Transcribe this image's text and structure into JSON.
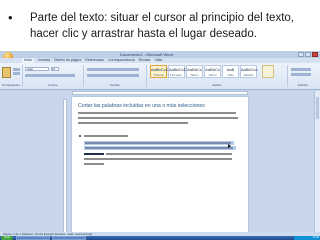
{
  "slide": {
    "bullet": "•",
    "text": "Parte del texto: situar el cursor al principio del texto, hacer clic y arrastrar hasta el lugar deseado."
  },
  "word_window": {
    "title": "Documento1 - Microsoft Word",
    "tabs": [
      "Inicio",
      "Insertar",
      "Diseño de página",
      "Referencias",
      "Correspondencia",
      "Revisar",
      "Vista"
    ],
    "active_tab": "Inicio",
    "font_name": "Arial",
    "font_size": "11",
    "groups": [
      "Portapapeles",
      "Fuente",
      "Párrafo",
      "Estilos",
      "Edición"
    ],
    "styles": [
      {
        "sample": "AaBbCcDc",
        "name": "¶ Normal"
      },
      {
        "sample": "AaBbCcDc",
        "name": "¶ Sin espa..."
      },
      {
        "sample": "AaBbCc",
        "name": "Título 1"
      },
      {
        "sample": "AaBbCc",
        "name": "Título 2"
      },
      {
        "sample": "AaB",
        "name": "Título"
      },
      {
        "sample": "AaBbCcc",
        "name": "Subtítulo"
      }
    ],
    "document_heading": "Cortar las palabras incluidas en una o más selecciones",
    "status_text": "Página: 1 de 1   Palabras: 12/133   Español (España - alfab. internacional)",
    "start_label": "Inicio",
    "clock": "17:32"
  },
  "colors": {
    "heading": "#2d5a8a",
    "selection": "#b7cbea"
  }
}
